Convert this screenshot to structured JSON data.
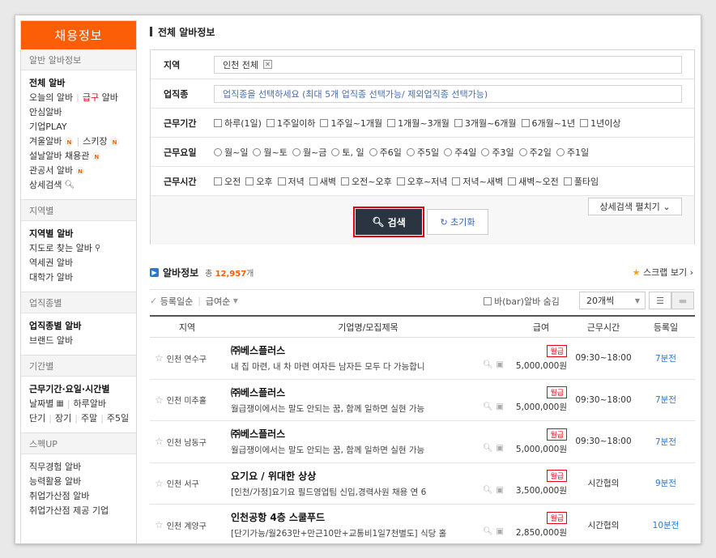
{
  "sidebar": {
    "title": "채용정보",
    "sections": [
      {
        "head": "알반 알바정보",
        "items": [
          {
            "label": "전체 알바",
            "bold": true
          },
          {
            "label": "오늘의 알바",
            "extra": "급구",
            "extra2": "알바"
          },
          {
            "label": "안심알바"
          },
          {
            "label": "기업PLAY"
          },
          {
            "label": "겨울알바",
            "badge": "N",
            "label2": "스키장",
            "badge2": "N"
          },
          {
            "label": "설날알바 채용관",
            "badge": "N"
          },
          {
            "label": "관공서 알바",
            "badge": "N"
          },
          {
            "label": "상세검색"
          }
        ]
      },
      {
        "head": "지역별",
        "items": [
          {
            "label": "지역별 알바",
            "bold": true
          },
          {
            "label": "지도로 찾는 알바"
          },
          {
            "label": "역세권 알바"
          },
          {
            "label": "대학가 알바"
          }
        ]
      },
      {
        "head": "업직종별",
        "items": [
          {
            "label": "업직종별 알바",
            "bold": true
          },
          {
            "label": "브랜드 알바"
          }
        ]
      },
      {
        "head": "기간별",
        "items": [
          {
            "label": "근무기간·요일·시간별",
            "bold": true
          },
          {
            "label": "날짜별",
            "label2": "하루알바"
          },
          {
            "label": "단기",
            "label2": "장기",
            "label3": "주말",
            "label4": "주5일"
          }
        ]
      },
      {
        "head": "스펙UP",
        "items": [
          {
            "label": "직무경험 알바"
          },
          {
            "label": "능력활용 알바"
          },
          {
            "label": "취업가산점 알바"
          },
          {
            "label": "취업가산점 제공 기업"
          }
        ]
      }
    ]
  },
  "main": {
    "title": "전체 알바정보",
    "search": {
      "region_label": "지역",
      "region_value": "인천 전체",
      "job_label": "업직종",
      "job_placeholder": "업직종을 선택하세요 (최대 5개 업직종 선택가능/ 제외업직종 선택가능)",
      "period_label": "근무기간",
      "period_opts": [
        "하루(1일)",
        "1주일이하",
        "1주일~1개월",
        "1개월~3개월",
        "3개월~6개월",
        "6개월~1년",
        "1년이상"
      ],
      "day_label": "근무요일",
      "day_opts": [
        "월~일",
        "월~토",
        "월~금",
        "토, 일",
        "주6일",
        "주5일",
        "주4일",
        "주3일",
        "주2일",
        "주1일"
      ],
      "time_label": "근무시간",
      "time_opts": [
        "오전",
        "오후",
        "저녁",
        "새벽",
        "오전~오후",
        "오후~저녁",
        "저녁~새벽",
        "새벽~오전",
        "풀타임"
      ],
      "search_btn": "검색",
      "reset_btn": "초기화",
      "more_btn": "상세검색 펼치기"
    },
    "list": {
      "title": "알바정보",
      "count_prefix": "총",
      "count": "12,957",
      "count_suffix": "개",
      "scrap": "스크랩 보기",
      "sort1": "등록일순",
      "sort2": "급여순",
      "bar_hide": "바(bar)알바 숨김",
      "per_page": "20개씩",
      "cols": [
        "지역",
        "기업명/모집제목",
        "급여",
        "근무시간",
        "등록일"
      ],
      "rows": [
        {
          "region": "인천 연수구",
          "name": "㈜베스플러스",
          "sub": "내 집 마련, 내 차 마련 여자든 남자든 모두 다 가능합니",
          "badge": "월급",
          "wage": "5,000,000원",
          "time": "09:30~18:00",
          "date": "7분전"
        },
        {
          "region": "인천 미추홀",
          "name": "㈜베스플러스",
          "sub": "월급쟁이에서는 말도 안되는 꿈, 함께 일하면 실현 가능",
          "badge": "월급",
          "wage": "5,000,000원",
          "time": "09:30~18:00",
          "date": "7분전"
        },
        {
          "region": "인천 남동구",
          "name": "㈜베스플러스",
          "sub": "월급쟁이에서는 말도 안되는 꿈, 함께 일하면 실현 가능",
          "badge": "월급",
          "wage": "5,000,000원",
          "time": "09:30~18:00",
          "date": "7분전"
        },
        {
          "region": "인천 서구",
          "name": "요기요 / 위대한 상상",
          "sub": "[인천/가정]요기요 필드영업팀 신입,경력사원 채용 연 6",
          "badge": "월급",
          "wage": "3,500,000원",
          "time": "시간협의",
          "date": "9분전"
        },
        {
          "region": "인천 계양구",
          "name": "인천공항 4층 스쿨푸드",
          "sub": "[단기가능/월263만+만근10만+교통비1일7천별도] 식당 홀",
          "badge": "월급",
          "wage": "2,850,000원",
          "time": "시간협의",
          "date": "10분전"
        }
      ]
    }
  }
}
